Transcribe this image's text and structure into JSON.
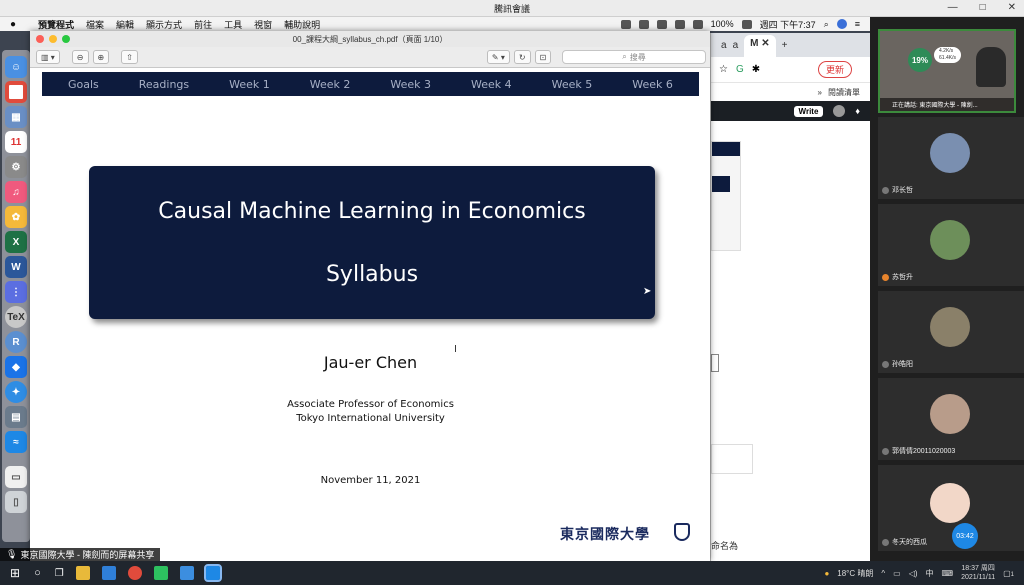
{
  "meeting": {
    "title": "騰訊會議"
  },
  "menubar": {
    "app_name": "預覽程式",
    "items": [
      "檔案",
      "編輯",
      "顯示方式",
      "前往",
      "工具",
      "視窗",
      "輔助說明"
    ],
    "battery": "100%",
    "clock": "週四 下午7:37"
  },
  "preview": {
    "doc_title": "00_課程大綱_syllabus_ch.pdf（頁面 1/10）",
    "search_placeholder": "搜尋",
    "nav_items": [
      "Goals",
      "Readings",
      "Week 1",
      "Week 2",
      "Week 3",
      "Week 4",
      "Week 5",
      "Week 6"
    ],
    "title_line1": "Causal Machine Learning in Economics",
    "title_line2": "Syllabus",
    "author": "Jau-er Chen",
    "affiliation_line1": "Associate Professor of Economics",
    "affiliation_line2": "Tokyo International University",
    "date": "November 11, 2021",
    "logo_text": "東京國際大學"
  },
  "chrome": {
    "update_label": "更新",
    "reading_list": "閱讀清單",
    "write_label": "Write",
    "partial_text": "命名為"
  },
  "share_label": "東京國際大學 - 陳劍而的屏幕共享",
  "participants": {
    "speaking_label": "正在講話: 東京國際大學 - 陳劍...",
    "cpu_percent": "19%",
    "net_up": "4.2K/s",
    "net_down": "61.4K/s",
    "list": [
      {
        "name": "邓长哲",
        "avatar_color": "#7a8fb0"
      },
      {
        "name": "苏哲升",
        "avatar_color": "#6d8f5a"
      },
      {
        "name": "孙皓阳",
        "avatar_color": "#8a8069"
      },
      {
        "name": "郭倩倩20011020003",
        "avatar_color": "#b89c8a"
      },
      {
        "name": "冬天的西瓜",
        "avatar_color": "#f2d7c8"
      }
    ],
    "timer": "03:42"
  },
  "taskbar": {
    "weather": "18°C 晴朗",
    "ime": "中",
    "time": "18:37 周四",
    "date": "2021/11/11",
    "notif_count": "1"
  },
  "colors": {
    "slide_navy": "#0d1b3d",
    "accent_green": "#2e8b57"
  }
}
